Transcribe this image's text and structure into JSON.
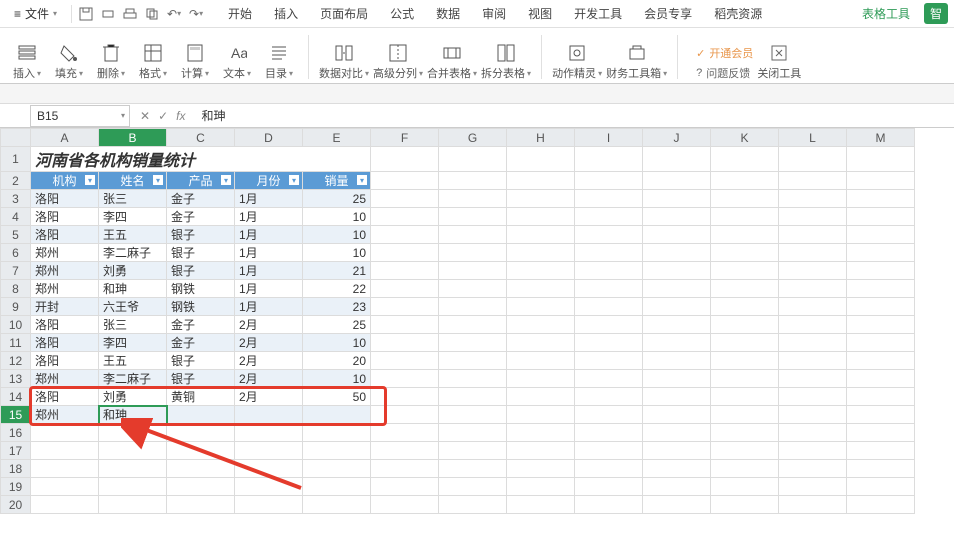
{
  "menubar": {
    "file": "文件",
    "tabs": [
      "开始",
      "插入",
      "页面布局",
      "公式",
      "数据",
      "审阅",
      "视图",
      "开发工具",
      "会员专享",
      "稻壳资源"
    ],
    "tool": "表格工具",
    "tag": "智"
  },
  "ribbon": {
    "items": [
      {
        "label": "插入",
        "icon": "rows"
      },
      {
        "label": "填充",
        "icon": "fill"
      },
      {
        "label": "删除",
        "icon": "delete"
      },
      {
        "label": "格式",
        "icon": "format"
      },
      {
        "label": "计算",
        "icon": "calc"
      },
      {
        "label": "文本",
        "icon": "text"
      },
      {
        "label": "目录",
        "icon": "toc"
      }
    ],
    "items2": [
      {
        "label": "数据对比",
        "icon": "compare"
      },
      {
        "label": "高级分列",
        "icon": "split"
      },
      {
        "label": "合并表格",
        "icon": "merge"
      },
      {
        "label": "拆分表格",
        "icon": "unmerge"
      }
    ],
    "items3": [
      {
        "label": "动作精灵",
        "icon": "macro"
      },
      {
        "label": "财务工具箱",
        "icon": "finance"
      }
    ],
    "links": {
      "member": "开通会员",
      "feedback": "问题反馈",
      "close": "关闭工具"
    }
  },
  "fx": {
    "name": "B15",
    "value": "和珅"
  },
  "sheet": {
    "cols": [
      "A",
      "B",
      "C",
      "D",
      "E",
      "F",
      "G",
      "H",
      "I",
      "J",
      "K",
      "L",
      "M"
    ],
    "title": "河南省各机构销量统计",
    "headers": [
      "机构",
      "姓名",
      "产品",
      "月份",
      "销量"
    ],
    "rows": [
      {
        "n": 3,
        "band": true,
        "c": [
          "洛阳",
          "张三",
          "金子",
          "1月",
          "25"
        ]
      },
      {
        "n": 4,
        "band": false,
        "c": [
          "洛阳",
          "李四",
          "金子",
          "1月",
          "10"
        ]
      },
      {
        "n": 5,
        "band": true,
        "c": [
          "洛阳",
          "王五",
          "银子",
          "1月",
          "10"
        ]
      },
      {
        "n": 6,
        "band": false,
        "c": [
          "郑州",
          "李二麻子",
          "银子",
          "1月",
          "10"
        ]
      },
      {
        "n": 7,
        "band": true,
        "c": [
          "郑州",
          "刘勇",
          "银子",
          "1月",
          "21"
        ]
      },
      {
        "n": 8,
        "band": false,
        "c": [
          "郑州",
          "和珅",
          "钢铁",
          "1月",
          "22"
        ]
      },
      {
        "n": 9,
        "band": true,
        "c": [
          "开封",
          "六王爷",
          "钢铁",
          "1月",
          "23"
        ]
      },
      {
        "n": 10,
        "band": false,
        "c": [
          "洛阳",
          "张三",
          "金子",
          "2月",
          "25"
        ]
      },
      {
        "n": 11,
        "band": true,
        "c": [
          "洛阳",
          "李四",
          "金子",
          "2月",
          "10"
        ]
      },
      {
        "n": 12,
        "band": false,
        "c": [
          "洛阳",
          "王五",
          "银子",
          "2月",
          "20"
        ]
      },
      {
        "n": 13,
        "band": true,
        "c": [
          "郑州",
          "李二麻子",
          "银子",
          "2月",
          "10"
        ]
      },
      {
        "n": 14,
        "band": false,
        "c": [
          "洛阳",
          "刘勇",
          "黄铜",
          "2月",
          "50"
        ]
      },
      {
        "n": 15,
        "band": true,
        "c": [
          "郑州",
          "和珅",
          "",
          "",
          ""
        ]
      }
    ],
    "blank_rows": [
      16,
      17,
      18,
      19,
      20
    ]
  }
}
